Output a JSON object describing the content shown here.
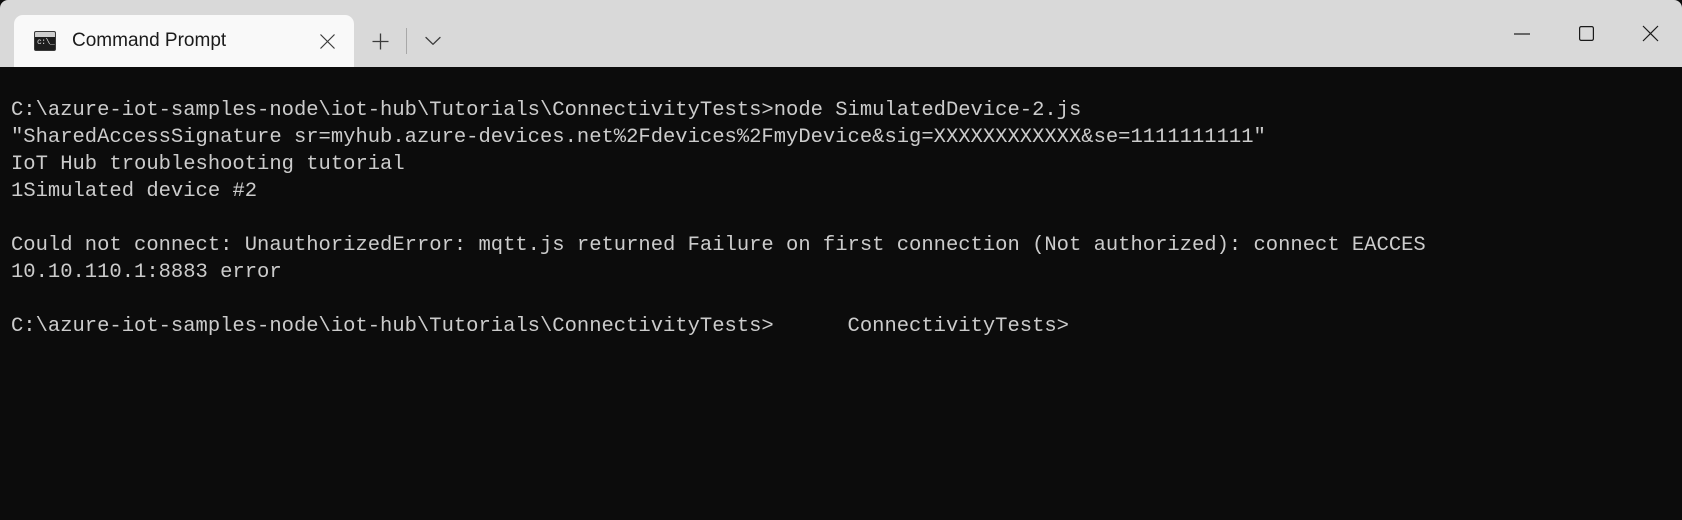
{
  "window": {
    "title": "Command Prompt",
    "controls": {
      "minimize_label": "Minimize",
      "maximize_label": "Maximize",
      "close_label": "Close"
    }
  },
  "tabstrip": {
    "tabs": [
      {
        "label": "Command Prompt",
        "icon": "command-prompt-icon",
        "close_label": "Close tab",
        "active": true
      }
    ],
    "new_tab_label": "+",
    "dropdown_label": "v"
  },
  "terminal": {
    "background": "#0c0c0c",
    "foreground": "#cccccc",
    "lines": [
      "C:\\azure-iot-samples-node\\iot-hub\\Tutorials\\ConnectivityTests>node SimulatedDevice-2.js",
      "\"SharedAccessSignature sr=myhub.azure-devices.net%2Fdevices%2FmyDevice&sig=XXXXXXXXXXXX&se=1111111111\"",
      "IoT Hub troubleshooting tutorial",
      "Simulated device #2",
      "",
      "Could not connect: UnauthorizedError: mqtt.js returned Failure on first connection (Not authorized): connect EACCES",
      "10.10.110.1:8883 error",
      "",
      "C:\\azure-iot-samples-node\\iot-hub\\Tutorials\\ConnectivityTests>      ConnectivityTests>"
    ],
    "artifact_glyph": "1",
    "artifact_line_index": 3
  }
}
